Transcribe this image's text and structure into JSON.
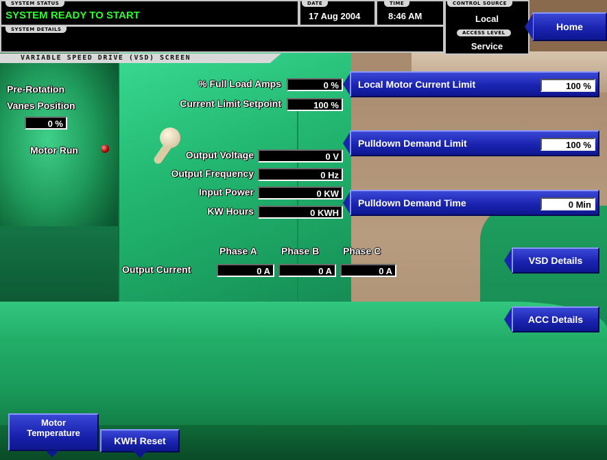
{
  "header": {
    "system_status_caption": "SYSTEM STATUS",
    "system_status": "SYSTEM READY TO START",
    "system_details_caption": "SYSTEM DETAILS",
    "system_details": "",
    "date_caption": "DATE",
    "date": "17 Aug 2004",
    "time_caption": "TIME",
    "time": "8:46 AM",
    "control_source_caption": "CONTROL SOURCE",
    "control_source": "Local",
    "access_level_caption": "ACCESS LEVEL",
    "access_level": "Service",
    "home_button": "Home"
  },
  "screen_title": "VARIABLE SPEED DRIVE (VSD) SCREEN",
  "left": {
    "prv_label_1": "Pre-Rotation",
    "prv_label_2": "Vanes Position",
    "prv_value": "0 %",
    "motor_run_label": "Motor Run"
  },
  "center": {
    "full_load_amps_label": "% Full Load Amps",
    "full_load_amps_value": "0 %",
    "current_limit_label": "Current Limit Setpoint",
    "current_limit_value": "100 %",
    "output_voltage_label": "Output Voltage",
    "output_voltage_value": "0 V",
    "output_frequency_label": "Output Frequency",
    "output_frequency_value": "0 Hz",
    "input_power_label": "Input Power",
    "input_power_value": "0 KW",
    "kw_hours_label": "KW Hours",
    "kw_hours_value": "0 KWH",
    "phase_a": "Phase A",
    "phase_b": "Phase B",
    "phase_c": "Phase C",
    "output_current_label": "Output Current",
    "phase_a_value": "0 A",
    "phase_b_value": "0 A",
    "phase_c_value": "0 A"
  },
  "right": {
    "local_motor_current_limit_label": "Local Motor Current Limit",
    "local_motor_current_limit_value": "100 %",
    "pulldown_demand_limit_label": "Pulldown Demand Limit",
    "pulldown_demand_limit_value": "100 %",
    "pulldown_demand_time_label": "Pulldown Demand Time",
    "pulldown_demand_time_value": "0 Min",
    "vsd_details_button": "VSD Details",
    "acc_details_button": "ACC Details"
  },
  "bottom": {
    "motor_temperature_line1": "Motor",
    "motor_temperature_line2": "Temperature",
    "kwh_reset_button": "KWH Reset"
  },
  "colors": {
    "status_green": "#2bff2b",
    "button_blue": "#1a24b0",
    "panel_green": "#23b872"
  }
}
